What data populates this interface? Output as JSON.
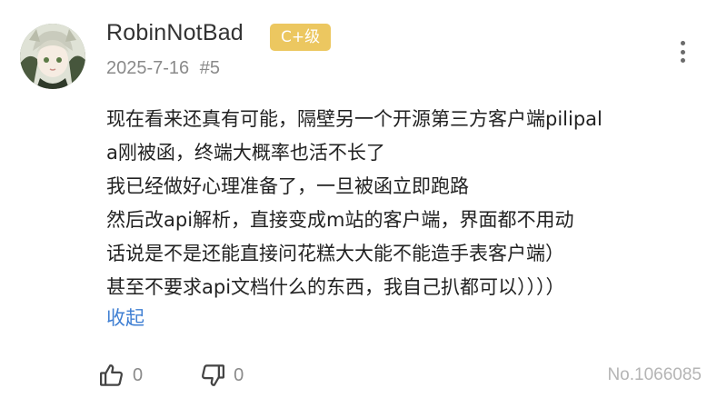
{
  "comment": {
    "username": "RobinNotBad",
    "level_badge": "C+级",
    "date": "2025-7-16",
    "floor": "#5",
    "lines": [
      "现在看来还真有可能，隔壁另一个开源第三方客户端pilipal",
      "a刚被函，终端大概率也活不长了",
      "我已经做好心理准备了，一旦被函立即跑路",
      "然后改api解析，直接变成m站的客户端，界面都不用动",
      "话说是不是还能直接问花糕大大能不能造手表客户端）",
      "甚至不要求api文档什么的东西，我自己扒都可以））））"
    ],
    "collapse_label": "收起",
    "like_count": "0",
    "dislike_count": "0",
    "comment_no": "No.1066085"
  },
  "icons": {
    "avatar": "anime-avatar",
    "more": "more-vertical-icon",
    "like": "thumbs-up-icon",
    "dislike": "thumbs-down-icon"
  },
  "colors": {
    "badge_bg": "#ecc760",
    "link": "#3f7fd3",
    "secondary_text": "#8a8a8a",
    "muted_text": "#b5b5b5"
  }
}
